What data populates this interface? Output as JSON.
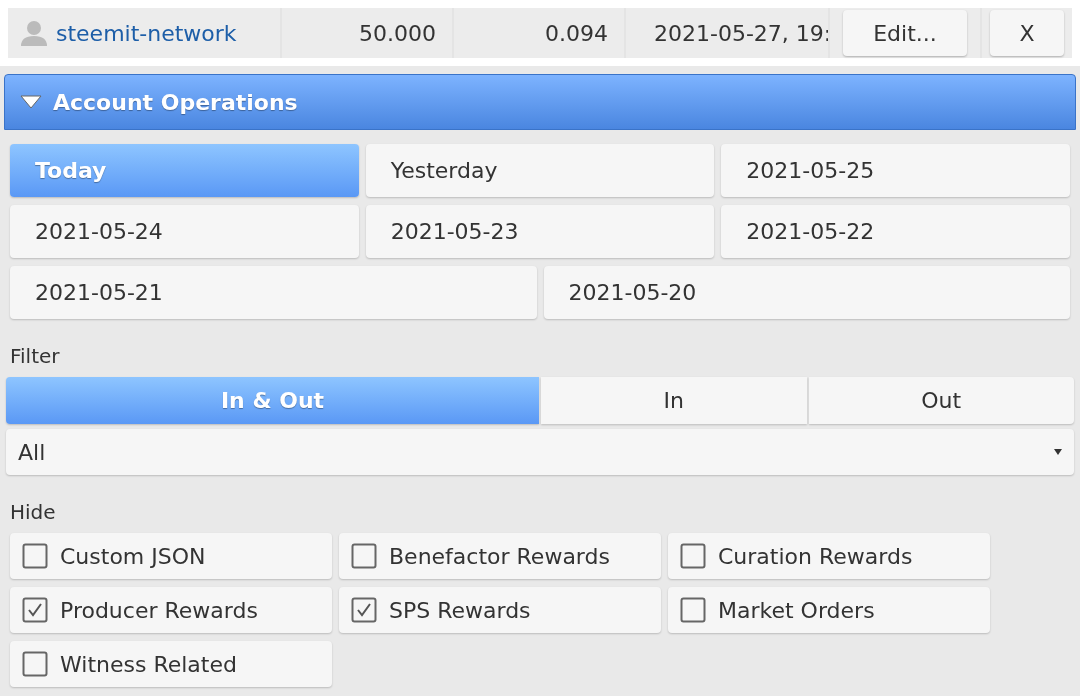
{
  "delegation_row": {
    "account": "steemit-network",
    "amount": "50.000",
    "column_3": "0.094",
    "date": "2021-05-27, 19:",
    "edit_button": "Edit...",
    "remove_button": "X"
  },
  "section": {
    "title": "Account Operations",
    "expanded": true
  },
  "days": [
    {
      "label": "Today",
      "selected": true
    },
    {
      "label": "Yesterday",
      "selected": false
    },
    {
      "label": "2021-05-25",
      "selected": false
    },
    {
      "label": "2021-05-24",
      "selected": false
    },
    {
      "label": "2021-05-23",
      "selected": false
    },
    {
      "label": "2021-05-22",
      "selected": false
    },
    {
      "label": "2021-05-21",
      "selected": false
    },
    {
      "label": "2021-05-20",
      "selected": false
    }
  ],
  "filter": {
    "label": "Filter",
    "directions": [
      {
        "label": "In & Out",
        "selected": true
      },
      {
        "label": "In",
        "selected": false
      },
      {
        "label": "Out",
        "selected": false
      }
    ],
    "type_select": "All"
  },
  "hide": {
    "label": "Hide",
    "options": [
      {
        "label": "Custom JSON",
        "checked": false
      },
      {
        "label": "Benefactor Rewards",
        "checked": false
      },
      {
        "label": "Curation Rewards",
        "checked": false
      },
      {
        "label": "Producer Rewards",
        "checked": true
      },
      {
        "label": "SPS Rewards",
        "checked": true
      },
      {
        "label": "Market Orders",
        "checked": false
      },
      {
        "label": "Witness Related",
        "checked": false
      }
    ]
  }
}
